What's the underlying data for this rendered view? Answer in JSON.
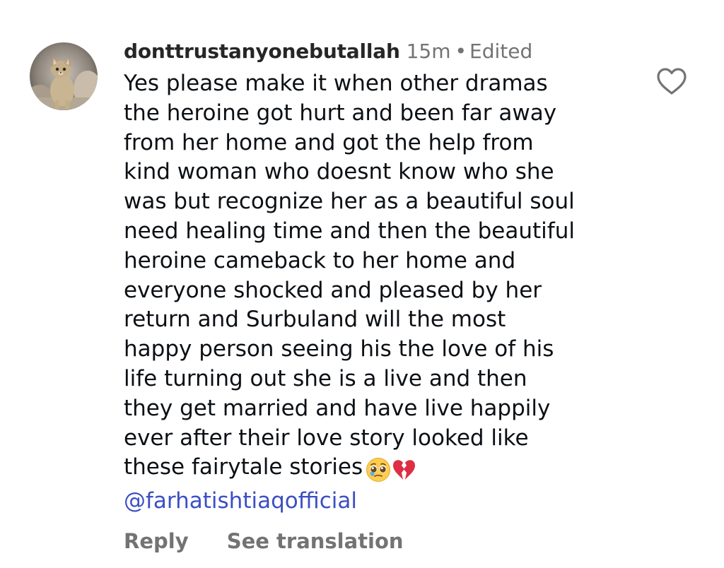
{
  "comment": {
    "username": "donttrustanyonebutallah",
    "time": "15m",
    "separator": "•",
    "edited": "Edited",
    "text_lines": [
      "Yes please make it when other dramas",
      "the heroine got hurt and been far away",
      "from her home and got the help from",
      "kind woman who doesnt know who she",
      "was but recognize her as a beautiful soul",
      "need healing time and then the beautiful",
      "heroine cameback to her home and",
      "everyone shocked and pleased by her",
      "return and Surbuland will the most",
      "happy person seeing his the love of his",
      "life turning out she is a live and then",
      "they get married and have live happily",
      "ever after their love story looked like",
      "these fairytale stories"
    ],
    "emojis": [
      "pleading-face-icon",
      "broken-heart-icon"
    ],
    "mention": "@farhatishtiaqofficial",
    "actions": {
      "reply": "Reply",
      "see_translation": "See translation"
    },
    "like_icon": "heart-outline-icon",
    "avatar": "cat-avatar"
  },
  "colors": {
    "username": "#262626",
    "muted": "#737373",
    "text": "#0c1014",
    "mention": "#3c4fc4",
    "heart_outline": "#737373"
  }
}
